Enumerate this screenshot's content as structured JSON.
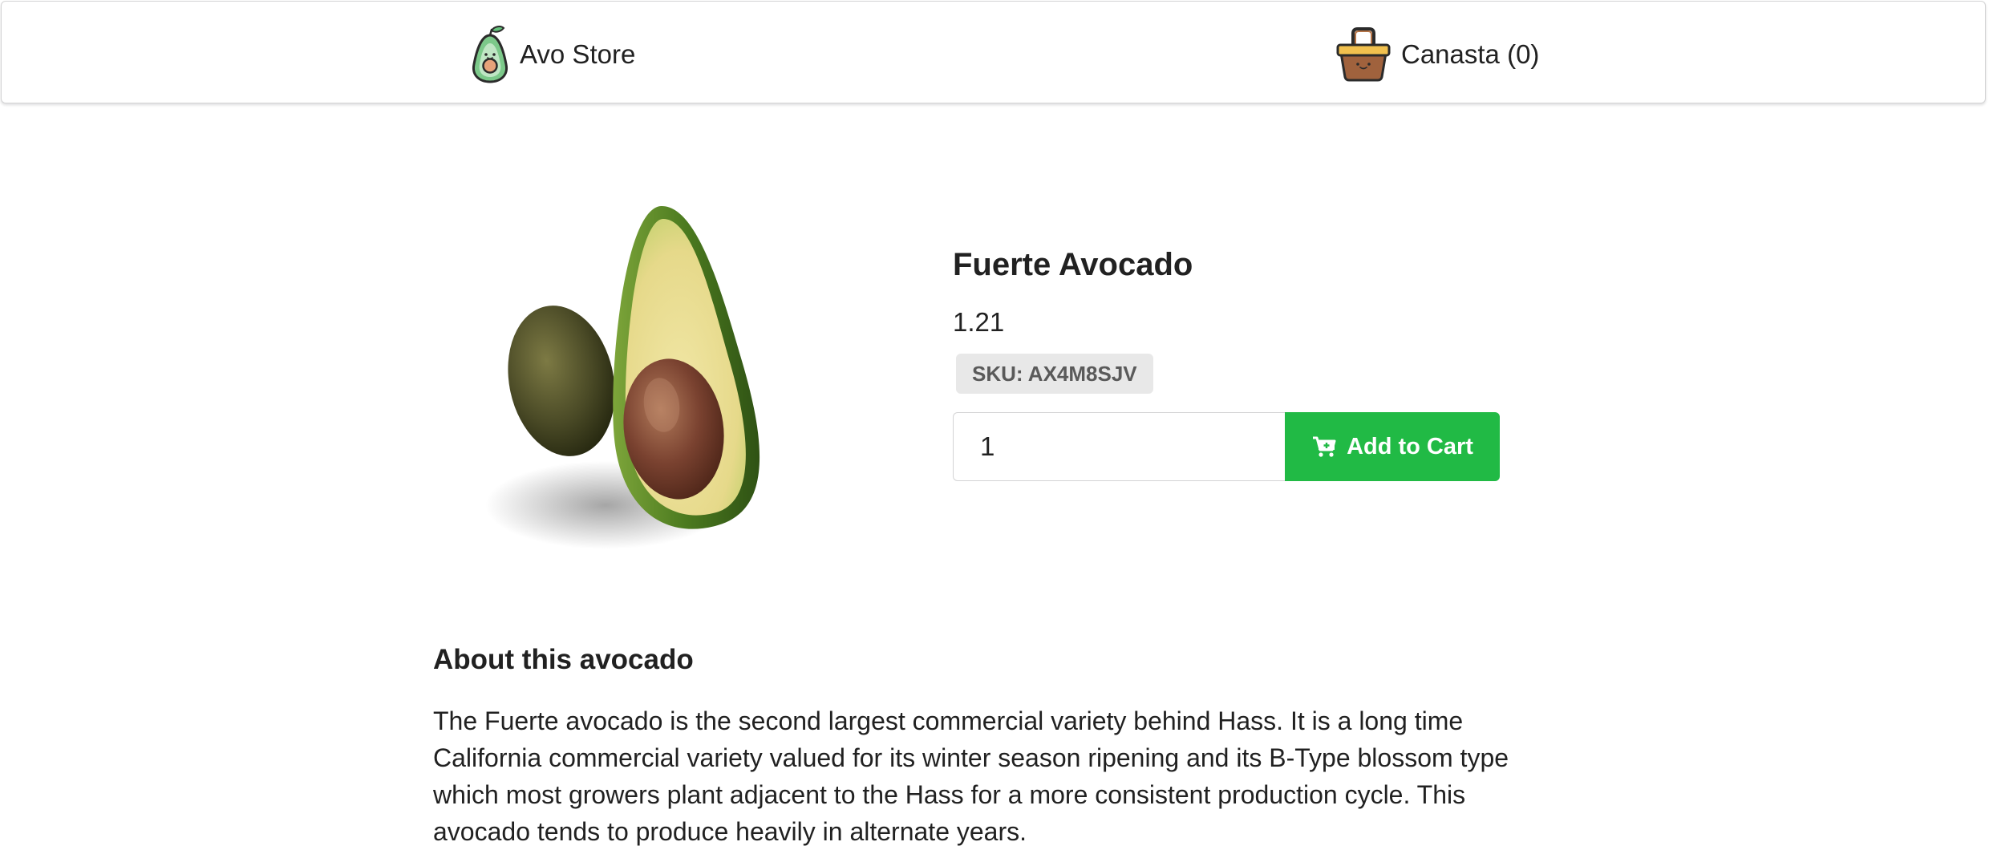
{
  "header": {
    "brand_label": "Avo Store",
    "brand_icon": "avocado-logo-icon",
    "cart_label": "Canasta (0)",
    "cart_icon": "basket-icon"
  },
  "product": {
    "image": "avocado-half-photo",
    "name": "Fuerte Avocado",
    "price": "1.21",
    "sku": "SKU: AX4M8SJV",
    "quantity": "1",
    "add_to_cart_label": "Add to Cart",
    "add_to_cart_icon": "cart-plus-icon",
    "accent_color": "#21ba45"
  },
  "about": {
    "heading": "About this avocado",
    "description": "The Fuerte avocado is the second largest commercial variety behind Hass. It is a long time California commercial variety valued for its winter season ripening and its B-Type blossom type which most growers plant adjacent to the Hass for a more consistent production cycle. This avocado tends to produce heavily in alternate years."
  }
}
